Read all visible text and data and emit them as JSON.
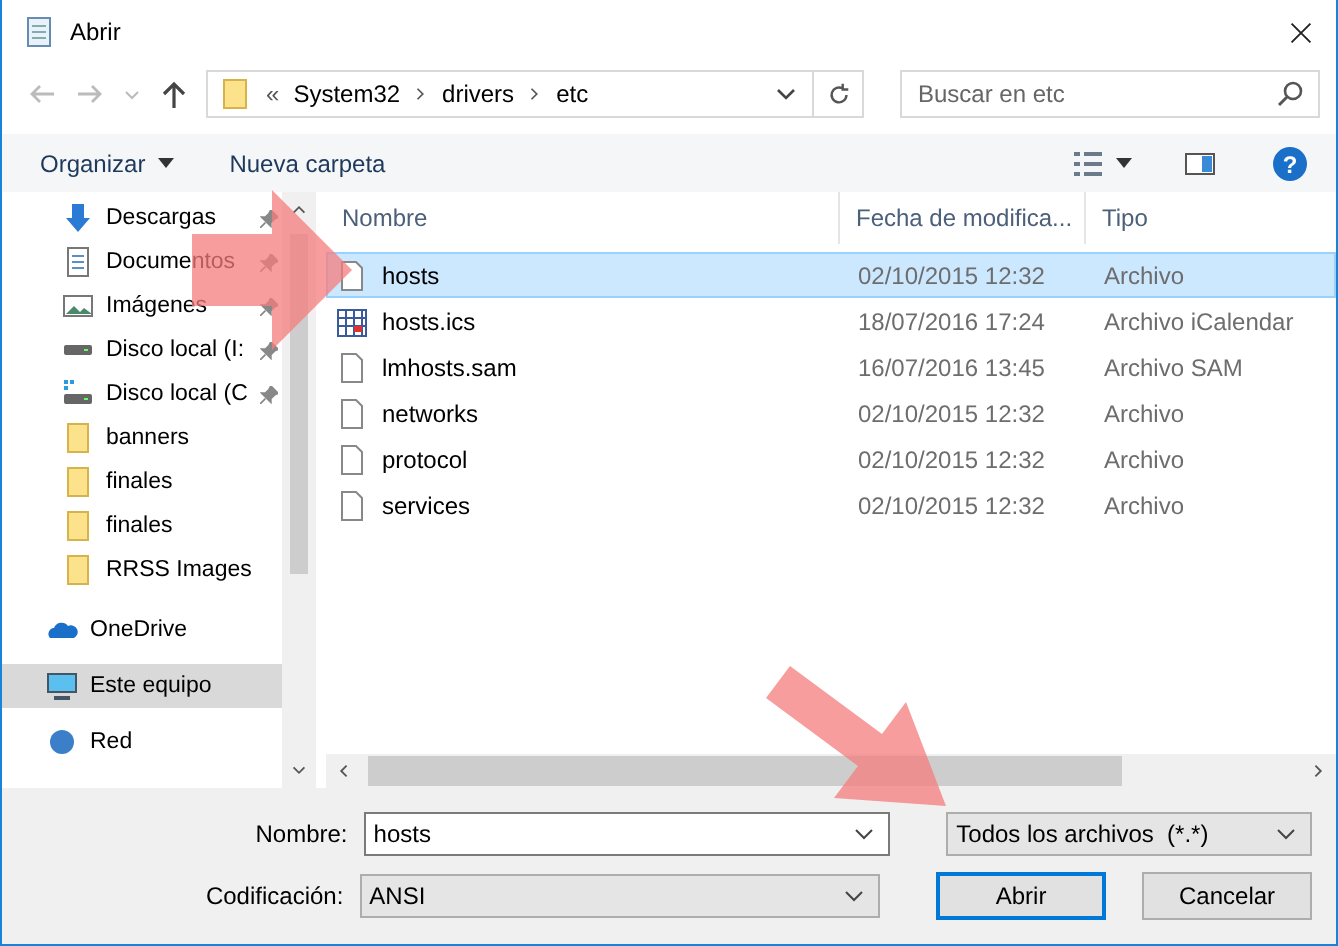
{
  "window": {
    "title": "Abrir"
  },
  "help": "?",
  "address": {
    "overflow": "«",
    "path": [
      "System32",
      "drivers",
      "etc"
    ]
  },
  "search": {
    "placeholder": "Buscar en etc"
  },
  "toolbar": {
    "organize": "Organizar",
    "new_folder": "Nueva carpeta"
  },
  "sidebar": {
    "items": [
      {
        "label": "Descargas",
        "kind": "download",
        "pinned": true,
        "selected": false
      },
      {
        "label": "Documentos",
        "kind": "document",
        "pinned": true,
        "selected": false
      },
      {
        "label": "Imágenes",
        "kind": "picture",
        "pinned": true,
        "selected": false
      },
      {
        "label": "Disco local (I:",
        "kind": "drive",
        "pinned": true,
        "selected": false
      },
      {
        "label": "Disco local (C",
        "kind": "system-drive",
        "pinned": true,
        "selected": false
      },
      {
        "label": "banners",
        "kind": "folder",
        "pinned": false,
        "selected": false
      },
      {
        "label": "finales",
        "kind": "folder",
        "pinned": false,
        "selected": false
      },
      {
        "label": "finales",
        "kind": "folder",
        "pinned": false,
        "selected": false
      },
      {
        "label": "RRSS Images",
        "kind": "folder",
        "pinned": false,
        "selected": false
      },
      {
        "label": "OneDrive",
        "kind": "cloud",
        "pinned": false,
        "selected": false
      },
      {
        "label": "Este equipo",
        "kind": "computer",
        "pinned": false,
        "selected": true
      },
      {
        "label": "Red",
        "kind": "network",
        "pinned": false,
        "selected": false
      }
    ]
  },
  "table": {
    "columns": [
      "Nombre",
      "Fecha de modifica...",
      "Tipo"
    ],
    "rows": [
      {
        "name": "hosts",
        "date": "02/10/2015 12:32",
        "type": "Archivo",
        "kind": "file",
        "selected": true
      },
      {
        "name": "hosts.ics",
        "date": "18/07/2016 17:24",
        "type": "Archivo iCalendar",
        "kind": "calendar",
        "selected": false
      },
      {
        "name": "lmhosts.sam",
        "date": "16/07/2016 13:45",
        "type": "Archivo SAM",
        "kind": "file",
        "selected": false
      },
      {
        "name": "networks",
        "date": "02/10/2015 12:32",
        "type": "Archivo",
        "kind": "file",
        "selected": false
      },
      {
        "name": "protocol",
        "date": "02/10/2015 12:32",
        "type": "Archivo",
        "kind": "file",
        "selected": false
      },
      {
        "name": "services",
        "date": "02/10/2015 12:32",
        "type": "Archivo",
        "kind": "file",
        "selected": false
      }
    ]
  },
  "footer": {
    "name_label": "Nombre:",
    "name_value": "hosts",
    "filter": "Todos los archivos  (*.*)",
    "encoding_label": "Codificación:",
    "encoding": "ANSI",
    "buttons": [
      {
        "label": "Abrir",
        "default": true
      },
      {
        "label": "Cancelar",
        "default": false
      }
    ]
  }
}
